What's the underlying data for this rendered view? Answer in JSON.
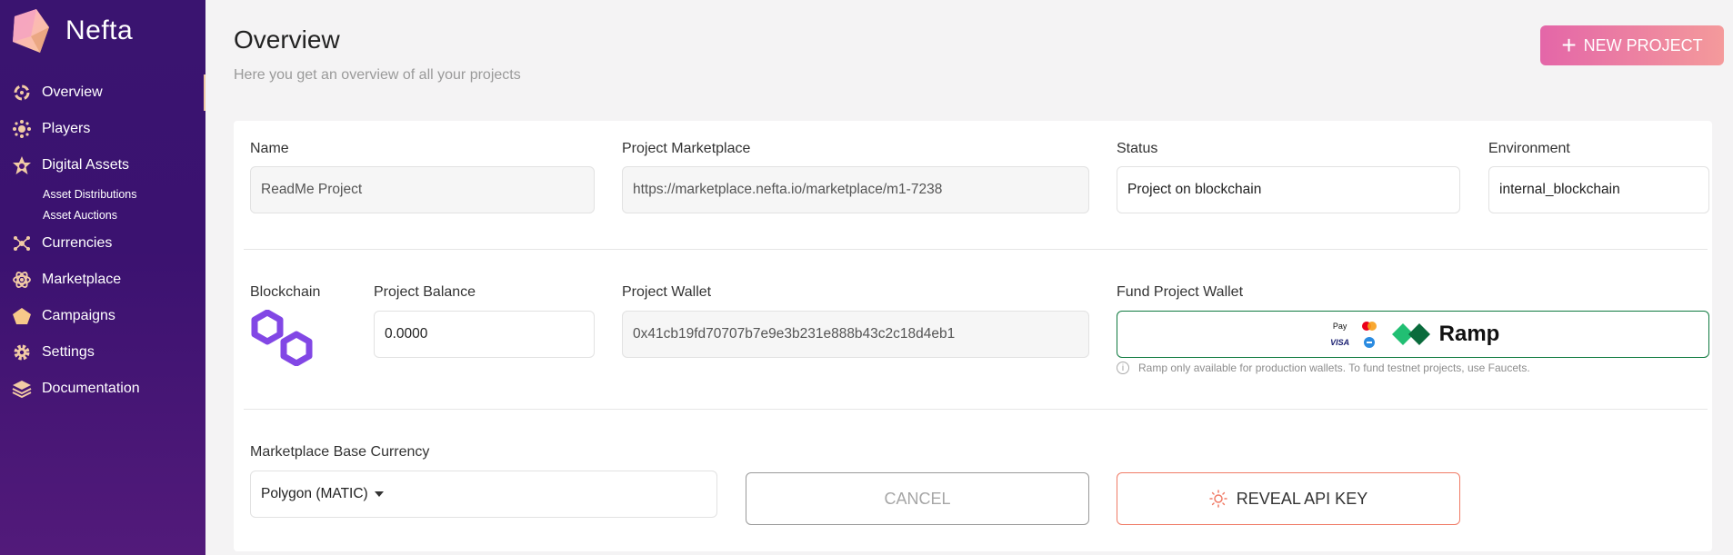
{
  "brand": {
    "name": "Nefta"
  },
  "sidebar": {
    "items": [
      {
        "label": "Overview",
        "icon": "overview-icon",
        "active": true
      },
      {
        "label": "Players",
        "icon": "players-icon"
      },
      {
        "label": "Digital Assets",
        "icon": "digital-assets-icon"
      },
      {
        "label": "Currencies",
        "icon": "currencies-icon"
      },
      {
        "label": "Marketplace",
        "icon": "marketplace-icon"
      },
      {
        "label": "Campaigns",
        "icon": "campaigns-icon"
      },
      {
        "label": "Settings",
        "icon": "settings-icon"
      },
      {
        "label": "Documentation",
        "icon": "documentation-icon"
      }
    ],
    "sub_items": [
      "Asset Distributions",
      "Asset Auctions"
    ]
  },
  "header": {
    "title": "Overview",
    "subtitle": "Here you get an overview of all your projects",
    "new_project_label": "NEW PROJECT"
  },
  "project": {
    "name_label": "Name",
    "name_value": "ReadMe Project",
    "marketplace_label": "Project Marketplace",
    "marketplace_value": "https://marketplace.nefta.io/marketplace/m1-7238",
    "status_label": "Status",
    "status_value": "Project on blockchain",
    "environment_label": "Environment",
    "environment_value": "internal_blockchain",
    "blockchain_label": "Blockchain",
    "balance_label": "Project Balance",
    "balance_value": "0.0000",
    "wallet_label": "Project Wallet",
    "wallet_value": "0x41cb19fd70707b7e9e3b231e888b43c2c18d4eb1",
    "fund_label": "Fund Project Wallet",
    "ramp_label": "Ramp",
    "pay_methods": [
      "Pay",
      "MC",
      "VISA",
      "Bank"
    ],
    "ramp_note": "Ramp only available for production wallets. To fund testnet projects, use Faucets.",
    "currency_label": "Marketplace Base Currency",
    "currency_value": "Polygon (MATIC)",
    "cancel_label": "CANCEL",
    "reveal_label": "REVEAL API KEY"
  },
  "colors": {
    "sidebar": "#3a1470",
    "accent_pink": "#e466a8",
    "ramp_green": "#0f7a3f",
    "polygon_purple": "#8247e5",
    "reveal_border": "#f07b66"
  }
}
